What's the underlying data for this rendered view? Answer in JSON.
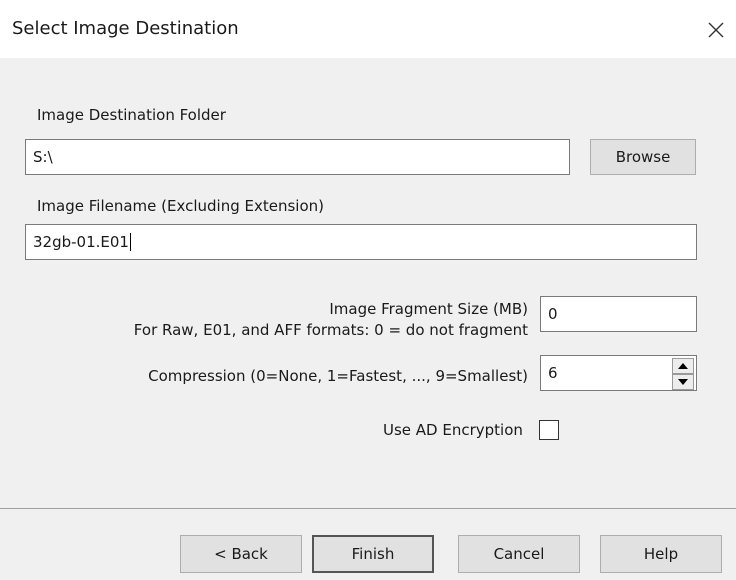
{
  "window": {
    "title": "Select Image Destination"
  },
  "dest_folder": {
    "label": "Image Destination Folder",
    "value": "S:\\"
  },
  "browse_label": "Browse",
  "filename": {
    "label": "Image Filename (Excluding Extension)",
    "value": "32gb-01.E01"
  },
  "fragment": {
    "label_line1": "Image Fragment Size (MB)",
    "label_line2": "For Raw, E01, and AFF formats: 0 = do not fragment",
    "value": "0"
  },
  "compression": {
    "label": "Compression (0=None, 1=Fastest, ..., 9=Smallest)",
    "value": "6"
  },
  "encryption": {
    "label": "Use AD Encryption",
    "checked": false
  },
  "buttons": {
    "back": "< Back",
    "finish": "Finish",
    "cancel": "Cancel",
    "help": "Help"
  }
}
